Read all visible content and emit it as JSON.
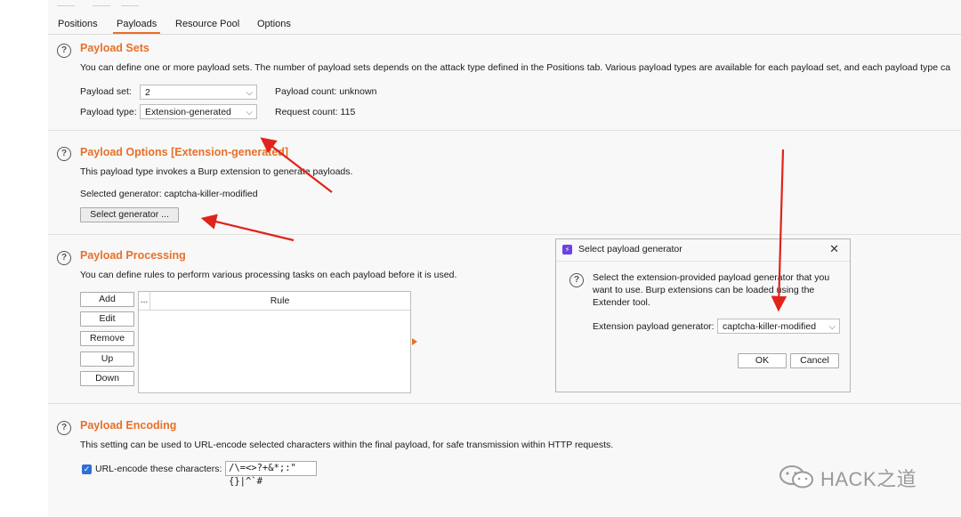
{
  "tabs": [
    "Positions",
    "Payloads",
    "Resource Pool",
    "Options"
  ],
  "active_tab": "Payloads",
  "payload_sets": {
    "title": "Payload Sets",
    "description": "You can define one or more payload sets. The number of payload sets depends on the attack type defined in the Positions tab. Various payload types are available for each payload set, and each payload type ca",
    "payload_set_label": "Payload set:",
    "payload_set_value": "2",
    "payload_count": "Payload count: unknown",
    "payload_type_label": "Payload type:",
    "payload_type_value": "Extension-generated",
    "request_count": "Request count: 115"
  },
  "payload_options": {
    "title": "Payload Options [Extension-generated]",
    "description": "This payload type invokes a Burp extension to generate payloads.",
    "selected_generator": "Selected generator: captcha-killer-modified",
    "select_button": "Select generator ..."
  },
  "payload_processing": {
    "title": "Payload Processing",
    "description": "You can define rules to perform various processing tasks on each payload before it is used.",
    "buttons": [
      "Add",
      "Edit",
      "Remove",
      "Up",
      "Down"
    ],
    "table_col1": "...",
    "table_col2": "Rule"
  },
  "dialog": {
    "title": "Select payload generator",
    "close": "✕",
    "text": "Select the extension-provided payload generator that you want to use. Burp extensions can be loaded using the Extender tool.",
    "generator_label": "Extension payload generator:",
    "generator_value": "captcha-killer-modified",
    "ok": "OK",
    "cancel": "Cancel"
  },
  "payload_encoding": {
    "title": "Payload Encoding",
    "description": "This setting can be used to URL-encode selected characters within the final payload, for safe transmission within HTTP requests.",
    "checkbox_label": "URL-encode these characters:",
    "checked": true,
    "characters": "/\\=<>?+&*;:\"{}|^`#"
  },
  "watermark": "HACK之道",
  "icons": {
    "help": "help-circle-icon",
    "chevron": "chevron-down-icon",
    "close": "close-icon",
    "app": "burp-app-icon",
    "check": "check-icon",
    "wechat": "wechat-logo-icon",
    "annotation": "red-arrow-annotation"
  },
  "colors": {
    "accent": "#e8702a",
    "annotation": "#e0231b",
    "checkbox": "#2f6fd8"
  }
}
